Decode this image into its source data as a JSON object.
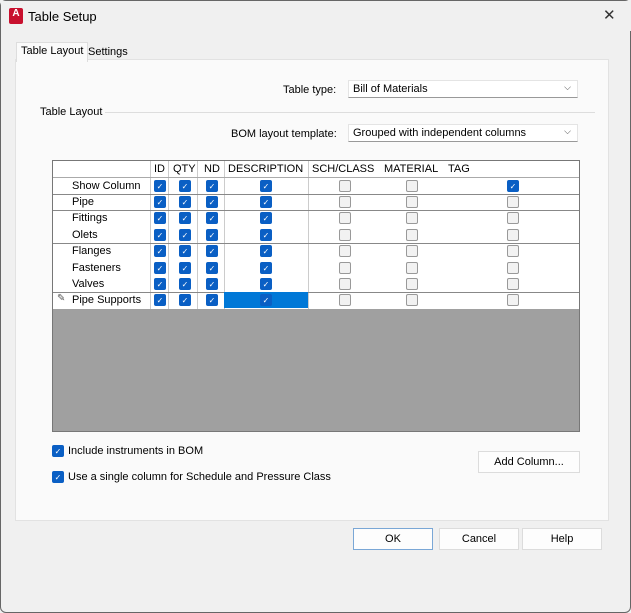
{
  "window": {
    "title": "Table Setup",
    "app_icon": "A"
  },
  "tabs": [
    {
      "label": "Table Layout",
      "active": true
    },
    {
      "label": "Settings",
      "active": false
    }
  ],
  "table_type": {
    "label": "Table type:",
    "value": "Bill of Materials"
  },
  "group_title": "Table Layout",
  "bom_template": {
    "label": "BOM layout template:",
    "value": "Grouped with independent columns"
  },
  "grid": {
    "columns": [
      "ID",
      "QTY",
      "ND",
      "DESCRIPTION",
      "SCH/CLASS",
      "MATERIAL",
      "TAG"
    ],
    "rows": [
      {
        "name": "Show Column",
        "checks": [
          true,
          true,
          true,
          true,
          false,
          false,
          true
        ]
      },
      {
        "name": "Pipe",
        "checks": [
          true,
          true,
          true,
          true,
          false,
          false,
          false
        ]
      },
      {
        "name": "Fittings",
        "checks": [
          true,
          true,
          true,
          true,
          false,
          false,
          false
        ]
      },
      {
        "name": "Olets",
        "checks": [
          true,
          true,
          true,
          true,
          false,
          false,
          false
        ]
      },
      {
        "name": "Flanges",
        "checks": [
          true,
          true,
          true,
          true,
          false,
          false,
          false
        ]
      },
      {
        "name": "Fasteners",
        "checks": [
          true,
          true,
          true,
          true,
          false,
          false,
          false
        ]
      },
      {
        "name": "Valves",
        "checks": [
          true,
          true,
          true,
          true,
          false,
          false,
          false
        ]
      },
      {
        "name": "Pipe Supports",
        "checks": [
          true,
          true,
          true,
          true,
          false,
          false,
          false
        ],
        "editing": true
      }
    ],
    "selection_color": "#0078d7"
  },
  "options": [
    {
      "label": "Include instruments in BOM",
      "checked": true
    },
    {
      "label": "Use a single column for Schedule and Pressure Class",
      "checked": true
    }
  ],
  "buttons": {
    "add_column": "Add Column...",
    "ok": "OK",
    "cancel": "Cancel",
    "help": "Help"
  }
}
